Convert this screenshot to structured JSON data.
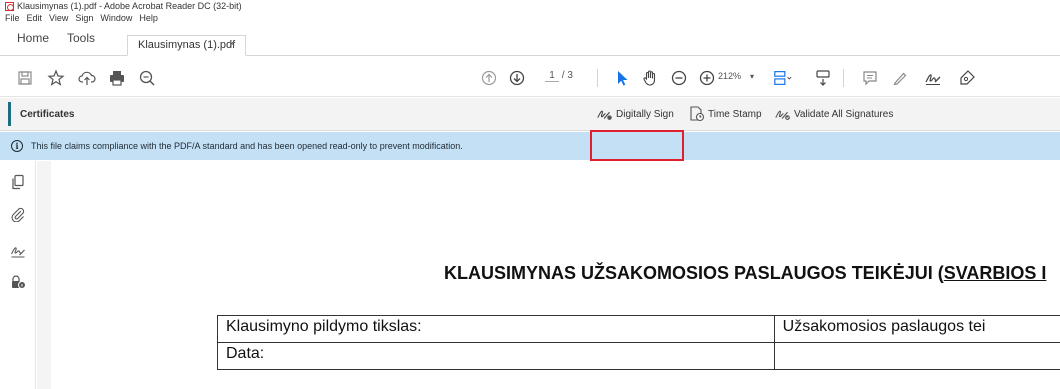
{
  "window": {
    "title": "Klausimynas (1).pdf - Adobe Acrobat Reader DC (32-bit)"
  },
  "menu": [
    "File",
    "Edit",
    "View",
    "Sign",
    "Window",
    "Help"
  ],
  "tabs": {
    "home": "Home",
    "tools": "Tools",
    "document": "Klausimynas (1).pdf",
    "close": "×"
  },
  "toolbar": {
    "page_current": "1",
    "page_total": "/ 3",
    "zoom": "212%",
    "zoom_caret": "▾",
    "icons": [
      "save-icon",
      "bookmark-star-icon",
      "cloud-upload-icon",
      "print-icon",
      "search-zoom-icon",
      "previous-page-icon",
      "next-page-icon",
      "select-cursor-icon",
      "hand-tool-icon",
      "zoom-out-icon",
      "zoom-in-icon",
      "page-display-icon",
      "scroll-mode-icon",
      "comment-icon",
      "highlight-pen-icon",
      "sign-icon",
      "fill-sign-icon"
    ]
  },
  "certificates": {
    "title": "Certificates",
    "digitally_sign": "Digitally Sign",
    "time_stamp": "Time Stamp",
    "validate_all": "Validate All Signatures"
  },
  "banner": {
    "icon": "i",
    "message": "This file claims compliance with the PDF/A standard and has been opened read-only to prevent modification."
  },
  "sidebar": {
    "icons": [
      "pages-icon",
      "attachments-icon",
      "signatures-icon",
      "security-lock-icon"
    ]
  },
  "document": {
    "heading_plain": "KLAUSIMYNAS UŽSAKOMOSIOS PASLAUGOS TEIKĖJUI (",
    "heading_underlined": "SVARBIOS I",
    "rows": [
      {
        "c1": "Klausimyno pildymo tikslas:",
        "c2": "Užsakomosios paslaugos tei"
      },
      {
        "c1": "Data:",
        "c2": ""
      }
    ]
  },
  "colors": {
    "banner_bg": "#c4e0f5",
    "highlight_border": "#e0202a",
    "accent": "#1f6e80",
    "active_tool": "#1473e6"
  }
}
